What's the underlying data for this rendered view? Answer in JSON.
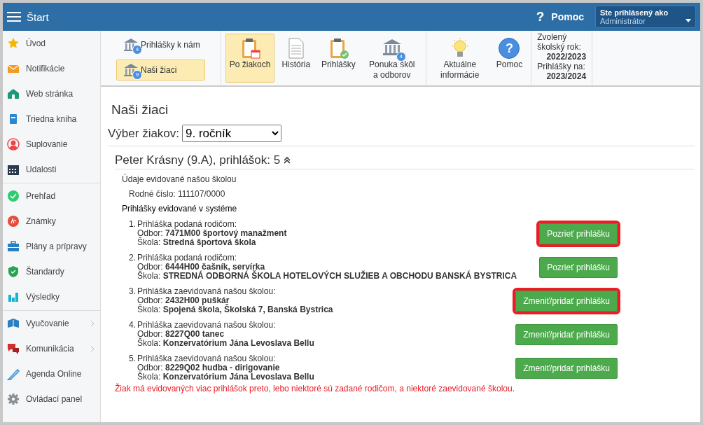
{
  "topbar": {
    "title": "Štart",
    "help_icon": "?",
    "help": "Pomoc",
    "user_label": "Ste prihlásený ako",
    "user_name": "Administrátor"
  },
  "sidebar": {
    "groups": [
      {
        "items": [
          {
            "label": "Úvod",
            "submenu": false
          },
          {
            "label": "Notifikácie",
            "submenu": false
          },
          {
            "label": "Web stránka",
            "submenu": false
          },
          {
            "label": "Triedna kniha",
            "submenu": false
          },
          {
            "label": "Suplovanie",
            "submenu": false
          },
          {
            "label": "Udalosti",
            "submenu": false
          }
        ]
      },
      {
        "items": [
          {
            "label": "Prehľad",
            "submenu": false
          },
          {
            "label": "Známky",
            "submenu": false
          },
          {
            "label": "Plány a prípravy",
            "submenu": false
          },
          {
            "label": "Štandardy",
            "submenu": false
          },
          {
            "label": "Výsledky",
            "submenu": false
          }
        ]
      },
      {
        "items": [
          {
            "label": "Vyučovanie",
            "submenu": true
          },
          {
            "label": "Komunikácia",
            "submenu": true
          },
          {
            "label": "Agenda Online",
            "submenu": false
          },
          {
            "label": "Ovládací panel",
            "submenu": false
          }
        ]
      }
    ]
  },
  "toolbar": {
    "side_buttons": [
      {
        "label": "Prihlášky k nám",
        "badge": "4",
        "selected": false
      },
      {
        "label": "Naši žiaci",
        "badge": "9",
        "selected": true
      }
    ],
    "groups": [
      [
        {
          "label": "Po žiakoch",
          "selected": true
        },
        {
          "label": "História",
          "selected": false
        },
        {
          "label": "Prihlášky",
          "selected": false
        },
        {
          "label": "Ponuka škôl a odborov",
          "badge": "4",
          "selected": false
        }
      ],
      [
        {
          "label": "Aktuálne informácie",
          "selected": false
        },
        {
          "label": "Pomoc",
          "icon_text": "?",
          "selected": false
        }
      ]
    ],
    "info": [
      {
        "label": "Zvolený školský rok:",
        "value": "2022/2023"
      },
      {
        "label": "Prihlášky na:",
        "value": "2023/2024"
      }
    ]
  },
  "main": {
    "title": "Naši žiaci",
    "selector_label": "Výber žiakov:",
    "selector_value": "9. ročník",
    "student": {
      "heading": "Peter Krásny (9.A), prihlášok: 5",
      "expanded": true,
      "school_data_title": "Údaje evidované našou školou",
      "birth_number": "Rodné číslo: 111107/0000",
      "applications_title": "Prihlášky evidované v systéme",
      "applications": [
        {
          "number": "1.",
          "heading": "Prihláška podaná rodičom:",
          "field": "Odbor: **7471M00 športový manažment**",
          "school": "Škola: **Stredná športová škola**",
          "button": "Pozrieť prihlášku",
          "highlighted": true
        },
        {
          "number": "2.",
          "heading": "Prihláška podaná rodičom:",
          "field": "Odbor: **6444H00 čašník, servírka**",
          "school": "Škola: **STREDNÁ ODBORNÁ ŠKOLA HOTELOVÝCH SLUŽIEB A OBCHODU BANSKÁ BYSTRICA**",
          "button": "Pozrieť prihlášku",
          "highlighted": false
        },
        {
          "number": "3.",
          "heading": "Prihláška zaevidovaná našou školou:",
          "field": "Odbor: **2432H00 puškár**",
          "school": "Škola: **Spojená škola, Školská 7, Banská Bystrica**",
          "button": "Zmeniť/pridať prihlášku",
          "highlighted": true
        },
        {
          "number": "4.",
          "heading": "Prihláška zaevidovaná našou školou:",
          "field": "Odbor: **8227Q00 tanec**",
          "school": "Škola: **Konzervatórium Jána Levoslava Bellu**",
          "button": "Zmeniť/pridať prihlášku",
          "highlighted": false
        },
        {
          "number": "5.",
          "heading": "Prihláška zaevidovaná našou školou:",
          "field": "Odbor: **8229Q02 hudba - dirigovanie**",
          "school": "Škola: **Konzervatórium Jána Levoslava Bellu**",
          "button": "Zmeniť/pridať prihlášku",
          "highlighted": false
        }
      ],
      "note": "Žiak má evidovaných viac prihlášok preto, lebo niektoré sú zadané rodičom, a niektoré zaevidované školou."
    }
  }
}
